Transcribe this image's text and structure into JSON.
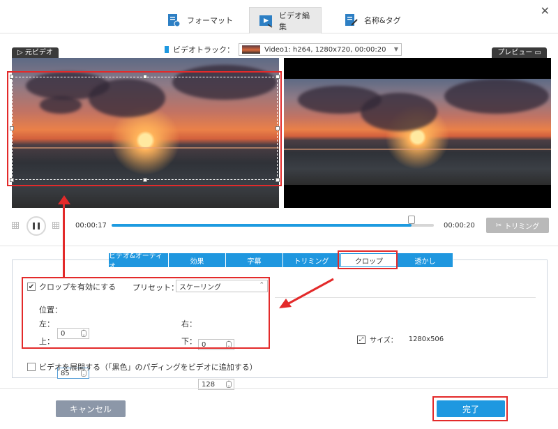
{
  "top_tabs": [
    {
      "label": "フォーマット"
    },
    {
      "label": "ビデオ編集"
    },
    {
      "label": "名称&タグ"
    }
  ],
  "viewer": {
    "source_label": "元ビデオ",
    "preview_label": "プレビュー",
    "track_label": "ビデオトラック：",
    "track_value": "Video1: h264, 1280x720, 00:00:20"
  },
  "playback": {
    "current_time": "00:00:17",
    "total_time": "00:00:20",
    "progress": 0.93,
    "trim_label": "トリミング"
  },
  "edit_tabs": [
    {
      "label": "ビデオ&オーディオ"
    },
    {
      "label": "効果"
    },
    {
      "label": "字幕"
    },
    {
      "label": "トリミング"
    },
    {
      "label": "クロップ"
    },
    {
      "label": "透かし"
    }
  ],
  "crop": {
    "enable_label": "クロップを有効にする",
    "enabled": true,
    "preset_label": "プリセット：",
    "preset_value": "スケーリング",
    "position_label": "位置：",
    "left_label": "左：",
    "left_value": "0",
    "right_label": "右：",
    "right_value": "0",
    "top_label": "上：",
    "top_value": "85",
    "bottom_label": "下：",
    "bottom_value": "128",
    "size_label": "サイズ：",
    "size_value": "1280x506",
    "expand_label": "ビデオを展開する（「黒色」のパディングをビデオに追加する）"
  },
  "footer": {
    "cancel_label": "キャンセル",
    "done_label": "完了"
  },
  "colors": {
    "accent": "#1e98e0",
    "highlight": "#e32a2a"
  }
}
